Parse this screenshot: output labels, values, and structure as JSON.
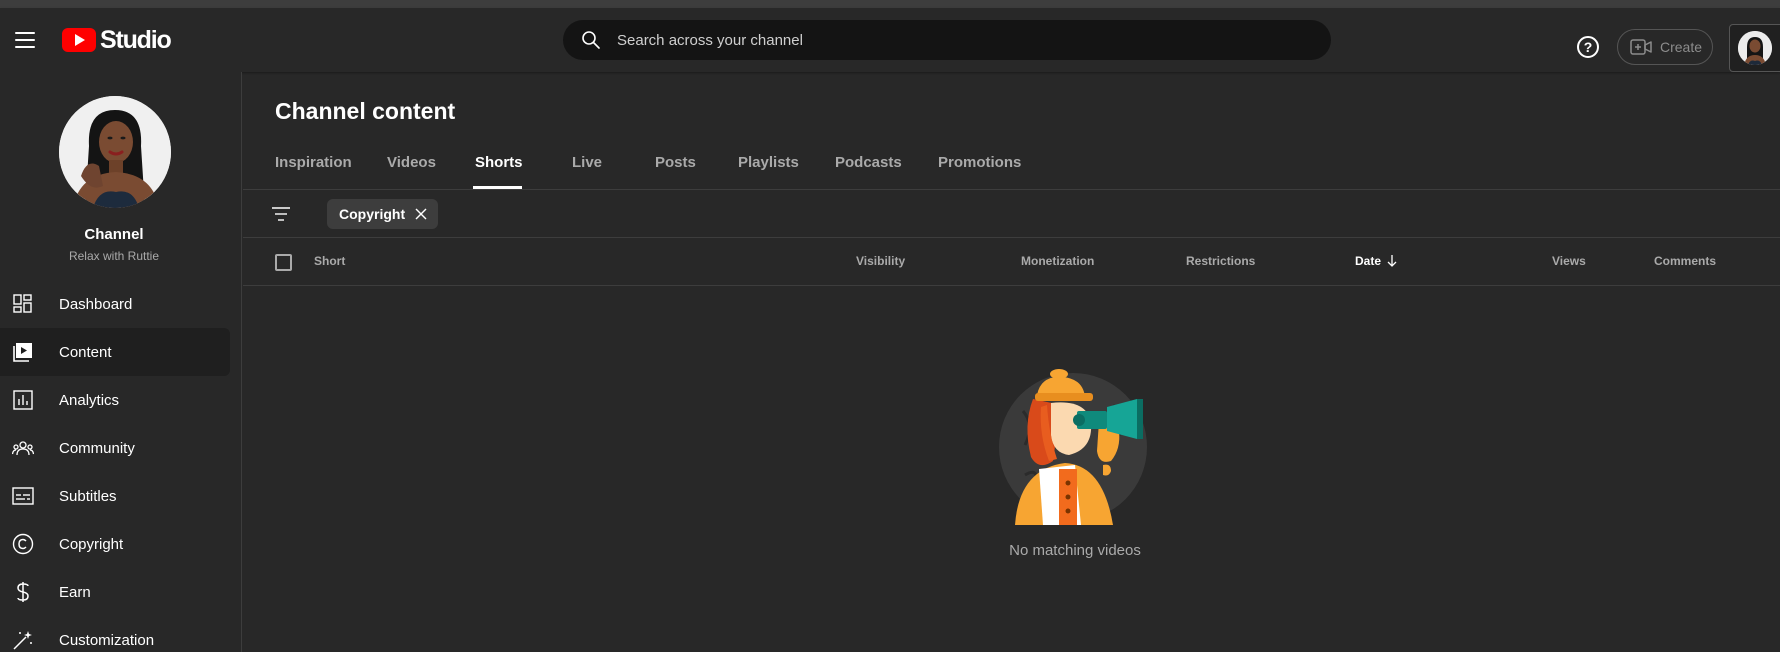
{
  "app": {
    "logo_text": "Studio"
  },
  "header": {
    "search_placeholder": "Search across your channel",
    "help_label": "?",
    "create_label": "Create"
  },
  "sidebar": {
    "channel_name": "Channel",
    "channel_subtitle": "Relax with Ruttie",
    "items": [
      {
        "label": "Dashboard",
        "icon": "dashboard-icon",
        "active": false
      },
      {
        "label": "Content",
        "icon": "content-icon",
        "active": true
      },
      {
        "label": "Analytics",
        "icon": "analytics-icon",
        "active": false
      },
      {
        "label": "Community",
        "icon": "community-icon",
        "active": false
      },
      {
        "label": "Subtitles",
        "icon": "subtitles-icon",
        "active": false
      },
      {
        "label": "Copyright",
        "icon": "copyright-icon",
        "active": false
      },
      {
        "label": "Earn",
        "icon": "earn-icon",
        "active": false
      },
      {
        "label": "Customization",
        "icon": "customization-icon",
        "active": false
      }
    ]
  },
  "main": {
    "title": "Channel content",
    "tabs": [
      "Inspiration",
      "Videos",
      "Shorts",
      "Live",
      "Posts",
      "Playlists",
      "Podcasts",
      "Promotions"
    ],
    "active_tab": "Shorts",
    "filter_chip": "Copyright",
    "columns": {
      "short": "Short",
      "visibility": "Visibility",
      "monetization": "Monetization",
      "restrictions": "Restrictions",
      "date": "Date",
      "views": "Views",
      "comments": "Comments"
    },
    "sort": {
      "column": "Date",
      "direction": "descending"
    },
    "empty_message": "No matching videos"
  },
  "colors": {
    "background": "#282828",
    "search_bg": "#141414",
    "brand_red": "#ff0000",
    "divider": "#3d3d3d",
    "muted_text": "#aaaaaa"
  }
}
